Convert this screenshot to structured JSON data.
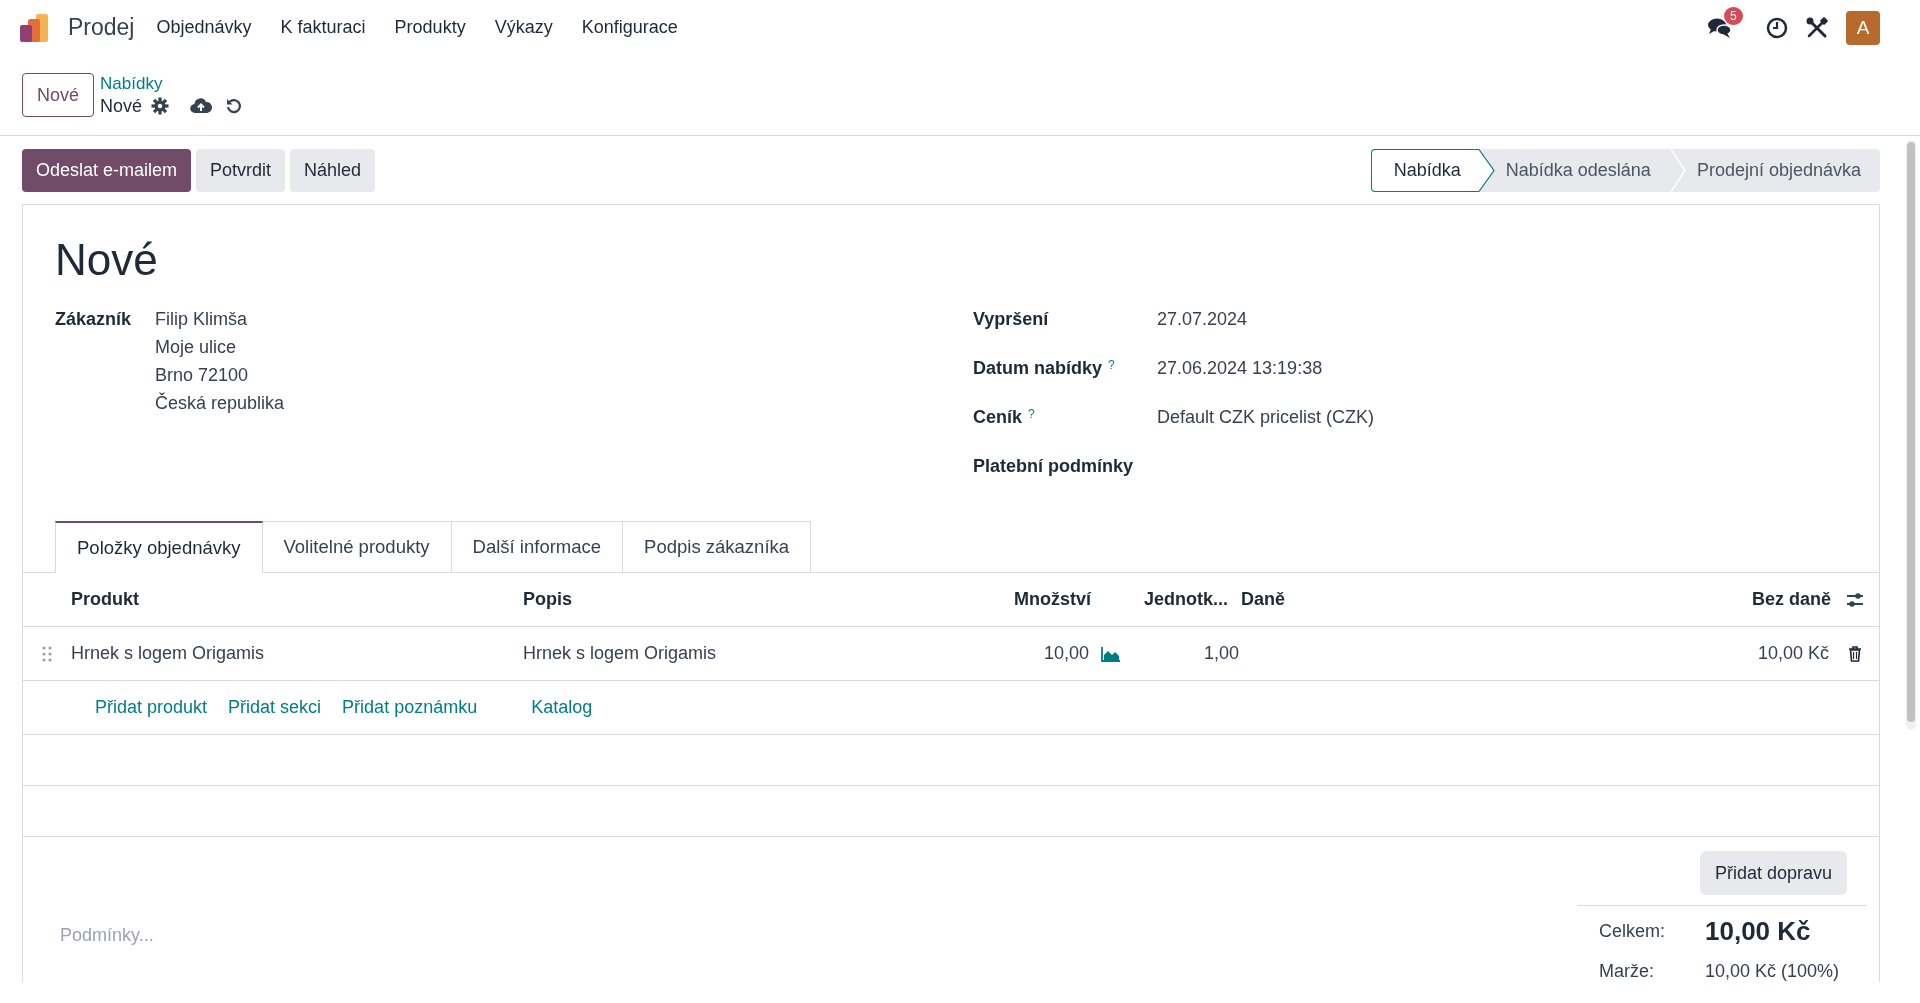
{
  "app": {
    "name": "Prodej"
  },
  "menu": [
    "Objednávky",
    "K fakturaci",
    "Produkty",
    "Výkazy",
    "Konfigurace"
  ],
  "systray": {
    "messages_badge": "5",
    "avatar": "A"
  },
  "control_panel": {
    "new_button": "Nové",
    "breadcrumb": "Nabídky",
    "record": "Nové"
  },
  "actions": [
    {
      "label": "Odeslat e-mailem",
      "primary": true
    },
    {
      "label": "Potvrdit",
      "primary": false
    },
    {
      "label": "Náhled",
      "primary": false
    }
  ],
  "stages": [
    {
      "label": "Nabídka",
      "selected": true
    },
    {
      "label": "Nabídka odeslána",
      "selected": false
    },
    {
      "label": "Prodejní objednávka",
      "selected": false
    }
  ],
  "title": "Nové",
  "customer": {
    "label": "Zákazník",
    "lines": [
      "Filip Klimša",
      "Moje ulice",
      "Brno 72100",
      "Česká republika"
    ]
  },
  "fields": [
    {
      "label": "Vypršení",
      "value": "27.07.2024"
    },
    {
      "label": "Datum nabídky",
      "help_mark": "?",
      "value": "27.06.2024 13:19:38"
    },
    {
      "label": "Ceník",
      "help_mark": "?",
      "value": "Default CZK pricelist (CZK)"
    },
    {
      "label": "Platební podmínky"
    }
  ],
  "tabs": [
    {
      "label": "Položky objednávky",
      "selected": true
    },
    {
      "label": "Volitelné produkty",
      "selected": false
    },
    {
      "label": "Další informace",
      "selected": false
    },
    {
      "label": "Podpis zákazníka",
      "selected": false
    }
  ],
  "table": {
    "columns": [
      "Produkt",
      "Popis",
      "Množství",
      "Jednotk...",
      "Daně",
      "Bez daně"
    ],
    "rows": [
      {
        "product": "Hrnek s logem Origamis",
        "description": "Hrnek s logem Origamis",
        "quantity": "10,00",
        "unit_price": "1,00",
        "subtotal": "10,00 Kč"
      }
    ],
    "add_links": [
      "Přidat produkt",
      "Přidat sekci",
      "Přidat poznámku",
      "Katalog"
    ]
  },
  "shipping_button": "Přidat dopravu",
  "terms_placeholder": "Podmínky...",
  "totals": [
    {
      "kind": "total",
      "label": "Celkem:",
      "value": "10,00 Kč"
    },
    {
      "kind": "margin",
      "label": "Marže:",
      "value": "10,00 Kč (100%)"
    }
  ]
}
